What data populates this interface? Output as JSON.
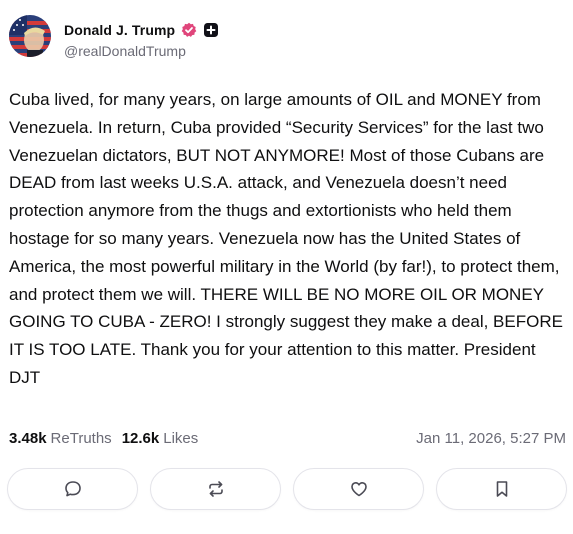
{
  "author": {
    "display_name": "Donald J. Trump",
    "handle": "@realDonaldTrump",
    "verified_icon": "verified-badge-icon",
    "extra_icon": "plus-square-icon",
    "accent_color": "#e0457b"
  },
  "post": {
    "text": "Cuba lived, for many years, on large amounts of OIL and MONEY from Venezuela. In return, Cuba provided “Security Services” for the last two Venezuelan dictators, BUT NOT ANYMORE! Most of those Cubans are DEAD from last weeks U.S.A. attack, and Venezuela doesn’t need protection anymore from the thugs and extortionists who held them hostage for so many years. Venezuela now has the United States of America, the most powerful military in the World (by far!), to protect them, and protect them we will. THERE WILL BE NO MORE OIL OR MONEY GOING TO CUBA - ZERO! I strongly suggest they make a deal, BEFORE IT IS TOO LATE. Thank you for your attention to this matter. President DJT"
  },
  "stats": {
    "retruths_count": "3.48k",
    "retruths_label": "ReTruths",
    "likes_count": "12.6k",
    "likes_label": "Likes",
    "timestamp": "Jan 11, 2026, 5:27 PM"
  },
  "actions": [
    {
      "name": "reply",
      "icon": "comment-icon"
    },
    {
      "name": "retruth",
      "icon": "retruth-icon"
    },
    {
      "name": "like",
      "icon": "heart-icon"
    },
    {
      "name": "bookmark",
      "icon": "bookmark-icon"
    }
  ]
}
